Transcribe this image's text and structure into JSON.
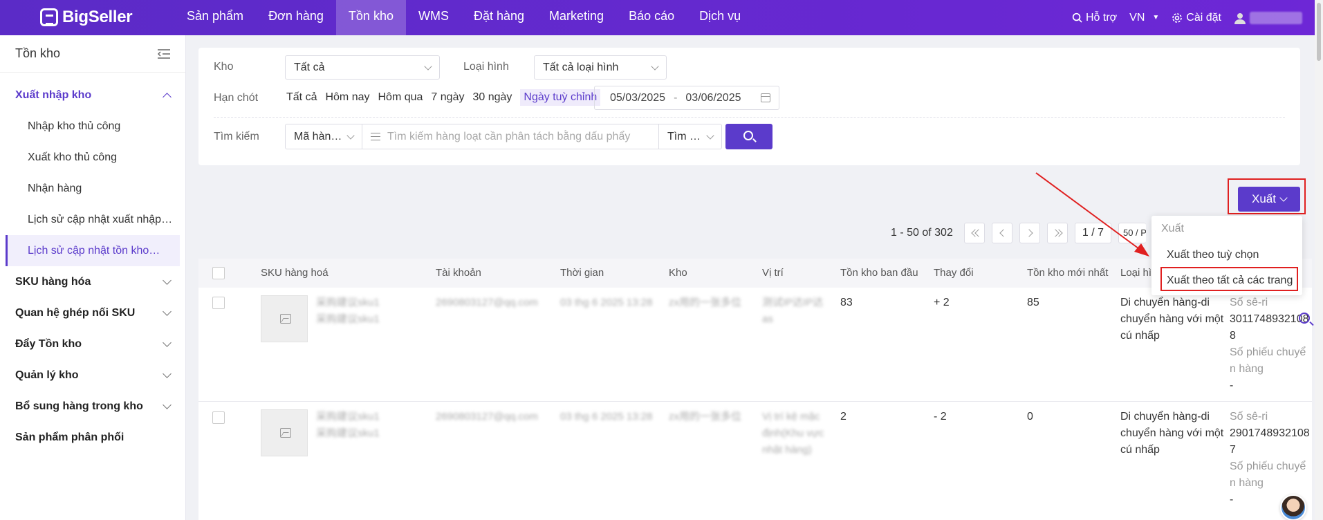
{
  "brand": {
    "name": "BigSeller"
  },
  "nav": {
    "items": [
      "Sản phẩm",
      "Đơn hàng",
      "Tồn kho",
      "WMS",
      "Đặt hàng",
      "Marketing",
      "Báo cáo",
      "Dịch vụ"
    ],
    "active_index": 2
  },
  "topright": {
    "support": "Hỗ trợ",
    "lang": "VN",
    "settings": "Cài đặt"
  },
  "sidebar": {
    "title": "Tồn kho",
    "open_group": "Xuất nhập kho",
    "sub_items": [
      "Nhập kho thủ công",
      "Xuất kho thủ công",
      "Nhận hàng",
      "Lịch sử cập nhật xuất nhập…",
      "Lịch sử cập nhật tồn kho…"
    ],
    "groups": [
      "SKU hàng hóa",
      "Quan hệ ghép nối SKU",
      "Đẩy Tồn kho",
      "Quản lý kho",
      "Bổ sung hàng trong kho",
      "Sản phẩm phân phối"
    ]
  },
  "filter": {
    "warehouse_label": "Kho",
    "warehouse_value": "Tất cả",
    "type_label": "Loại hình",
    "type_value": "Tất cả loại hình",
    "deadline_label": "Hạn chót",
    "quick": [
      "Tất cả",
      "Hôm nay",
      "Hôm qua",
      "7 ngày",
      "30 ngày",
      "Ngày tuỳ chỉnh"
    ],
    "date_from": "05/03/2025",
    "date_sep": "-",
    "date_to": "03/06/2025",
    "search_label": "Tìm kiếm",
    "search_field": "Mã hàn…",
    "search_placeholder": "Tìm kiếm hàng loạt cần phân tách bằng dấu phẩy",
    "search_mode": "Tìm …"
  },
  "export": {
    "button": "Xuất",
    "menu_title": "Xuất",
    "menu_items": [
      "Xuất theo tuỳ chọn",
      "Xuất theo tất cả các trang"
    ]
  },
  "pager": {
    "range": "1 - 50 of 302",
    "page": "1 / 7",
    "size": "50 / P"
  },
  "table": {
    "headers": [
      "SKU hàng hoá",
      "Tài khoản",
      "Thời gian",
      "Kho",
      "Vị trí",
      "Tồn kho ban đầu",
      "Thay đổi",
      "Tồn kho mới nhất",
      "Loại hì"
    ],
    "rows": [
      {
        "sku_line1": "采购建议sku1",
        "sku_line2": "采购建议sku1",
        "account": "2690803127@qq.com",
        "time": "03 thg 6 2025 13:28",
        "warehouse": "zx用的一张多位",
        "location": "测试IP达IP达 as",
        "initial": "83",
        "change": "+ 2",
        "latest": "85",
        "type": "Di chuyển hàng-di chuyển hàng với một cú nhấp",
        "serial_label": "Số sê-ri",
        "serial": "3011748932108 8",
        "voucher_label": "Số phiếu chuyển hàng",
        "voucher": "-"
      },
      {
        "sku_line1": "采购建议sku1",
        "sku_line2": "采购建议sku1",
        "account": "2690803127@qq.com",
        "time": "03 thg 6 2025 13:28",
        "warehouse": "zx用的一张多位",
        "location": "Vị trí kệ mặc định(Khu vực nhặt hàng)",
        "initial": "2",
        "change": "- 2",
        "latest": "0",
        "type": "Di chuyển hàng-di chuyển hàng với một cú nhấp",
        "serial_label": "Số sê-ri",
        "serial": "2901748932108 7",
        "voucher_label": "Số phiếu chuyển hàng",
        "voucher": "-"
      }
    ]
  },
  "colors": {
    "brand": "#5b3bcb",
    "highlight": "#e02020"
  }
}
